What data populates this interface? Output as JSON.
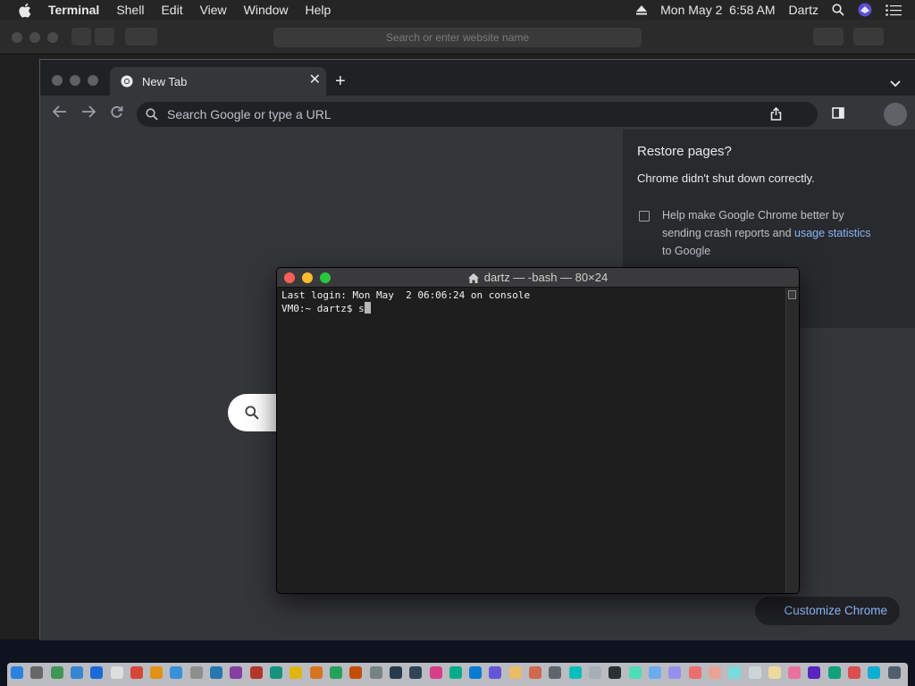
{
  "menubar": {
    "app_name": "Terminal",
    "menus": [
      "Shell",
      "Edit",
      "View",
      "Window",
      "Help"
    ],
    "clock": "Mon May 2  6:58 AM",
    "user": "Dartz"
  },
  "safari": {
    "address_placeholder": "Search or enter website name"
  },
  "chrome": {
    "tab_title": "New Tab",
    "omnibox_placeholder": "Search Google or type a URL",
    "restore": {
      "title": "Restore pages?",
      "subtitle": "Chrome didn't shut down correctly.",
      "checkbox_text": "Help make Google Chrome better by sending crash reports and",
      "checkbox_link": "usage statistics",
      "checkbox_tail": "to Google"
    },
    "customize_label": "Customize Chrome"
  },
  "terminal": {
    "title": "dartz — -bash — 80×24",
    "line1": "Last login: Mon May  2 06:06:24 on console",
    "prompt": "VM0:~ dartz$ s"
  },
  "dock": {
    "icon_colors": [
      "#2d8cf0",
      "#6f6f6f",
      "#46a35e",
      "#3b8ee0",
      "#1a73e8",
      "#f0f0f0",
      "#e74c3c",
      "#f39c12",
      "#3d9be9",
      "#999999",
      "#2980b9",
      "#8e44ad",
      "#c0392b",
      "#16a085",
      "#f1c40f",
      "#e67e22",
      "#27ae60",
      "#d35400",
      "#7f8c8d",
      "#2c3e50",
      "#34495e",
      "#e84393",
      "#00b894",
      "#0984e3",
      "#6c5ce7",
      "#fdcb6e",
      "#e17055",
      "#636e72",
      "#00cec9",
      "#b2bec3",
      "#2d3436",
      "#55efc4",
      "#74b9ff",
      "#a29bfe",
      "#ff7675",
      "#fab1a0",
      "#81ecec",
      "#dfe6e9",
      "#ffeaa7",
      "#fd79a8",
      "#5f27cd",
      "#10ac84",
      "#ee5253",
      "#0abde3",
      "#576574"
    ]
  }
}
